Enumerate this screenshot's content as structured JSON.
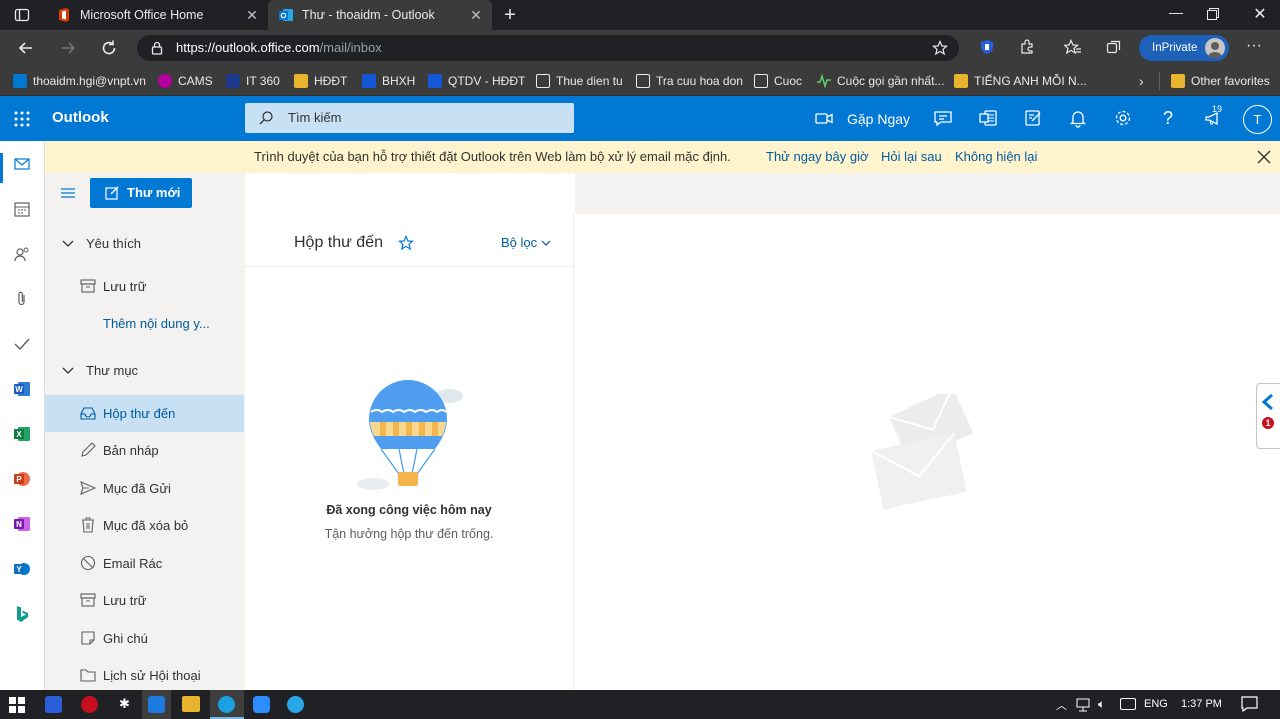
{
  "browser": {
    "tabs": [
      {
        "title": "Microsoft Office Home",
        "active": false
      },
      {
        "title": "Thư - thoaidm - Outlook",
        "active": true
      }
    ],
    "address": {
      "host": "https://outlook.office.com",
      "path": "/mail/inbox"
    },
    "inprivate_label": "InPrivate",
    "favorites": [
      {
        "label": "thoaidm.hgi@vnpt.vn",
        "icon": "outlook-icon"
      },
      {
        "label": "CAMS",
        "icon": "cams-icon"
      },
      {
        "label": "IT 360",
        "icon": "it360-icon"
      },
      {
        "label": "HĐĐT",
        "icon": "folder-icon"
      },
      {
        "label": "BHXH",
        "icon": "bhxh-icon"
      },
      {
        "label": "QTDV - HĐĐT",
        "icon": "qtdv-icon"
      },
      {
        "label": "Thue dien tu",
        "icon": "page-icon"
      },
      {
        "label": "Tra cuu hoa don",
        "icon": "page-icon"
      },
      {
        "label": "Cuoc",
        "icon": "page-icon"
      },
      {
        "label": "Cuộc gọi gần nhất...",
        "icon": "activity-icon"
      },
      {
        "label": "TIẾNG ANH MỖI N...",
        "icon": "folder-icon"
      }
    ],
    "other_favorites": "Other favorites"
  },
  "header": {
    "app_name": "Outlook",
    "search_placeholder": "Tìm kiếm",
    "meet_now": "Gặp Ngay",
    "notification_count": "19",
    "avatar_initial": "T",
    "accent": "#0078d4"
  },
  "banner": {
    "message": "Trình duyệt của bạn hỗ trợ thiết đặt Outlook trên Web làm bộ xử lý email mặc định.",
    "try_now": "Thử ngay bây giờ",
    "ask_later": "Hỏi lại sau",
    "dont_show": "Không hiện lại"
  },
  "nav": {
    "new_mail": "Thư mới",
    "favorites_header": "Yêu thích",
    "favorites": [
      {
        "label": "Lưu trữ",
        "icon": "archive-icon"
      },
      {
        "label": "Thêm nội dung y...",
        "icon": ""
      }
    ],
    "folders_header": "Thư mục",
    "folders": [
      {
        "label": "Hộp thư đến",
        "icon": "inbox-icon",
        "selected": true
      },
      {
        "label": "Bản nháp",
        "icon": "pencil-icon"
      },
      {
        "label": "Mục đã Gửi",
        "icon": "send-icon"
      },
      {
        "label": "Mục đã xóa bỏ",
        "icon": "trash-icon"
      },
      {
        "label": "Email Rác",
        "icon": "blocked-icon"
      },
      {
        "label": "Lưu trữ",
        "icon": "archive-icon"
      },
      {
        "label": "Ghi chú",
        "icon": "note-icon"
      },
      {
        "label": "Lịch sử Hội thoại",
        "icon": "folder-icon"
      }
    ]
  },
  "message_list": {
    "title": "Hộp thư đến",
    "filter": "Bộ lọc",
    "empty_title": "Đã xong công việc hôm nay",
    "empty_subtitle": "Tận hưởng hộp thư đến trống."
  },
  "side_badge": "1",
  "taskbar": {
    "language": "ENG",
    "time": "1:37 PM"
  }
}
